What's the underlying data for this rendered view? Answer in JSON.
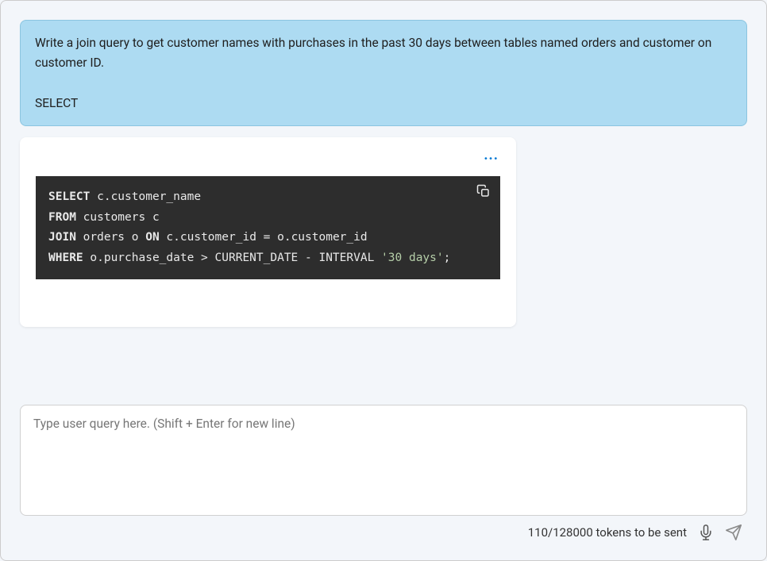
{
  "user_message": {
    "text": "Write a join query to get customer names with purchases in the past 30 days between tables named orders and customer on customer ID.",
    "suffix": "SELECT"
  },
  "assistant": {
    "more_label": "...",
    "code": {
      "line1_kw1": "SELECT",
      "line1_rest": " c.customer_name",
      "line2_kw": "FROM",
      "line2_rest": " customers c",
      "line3_kw1": "JOIN",
      "line3_mid": " orders o ",
      "line3_kw2": "ON",
      "line3_rest": " c.customer_id = o.customer_id",
      "line4_kw": "WHERE",
      "line4_mid": " o.purchase_date > CURRENT_DATE - INTERVAL ",
      "line4_str": "'30 days'",
      "line4_end": ";"
    }
  },
  "input": {
    "placeholder": "Type user query here. (Shift + Enter for new line)",
    "value": ""
  },
  "footer": {
    "tokens": "110/128000 tokens to be sent"
  }
}
